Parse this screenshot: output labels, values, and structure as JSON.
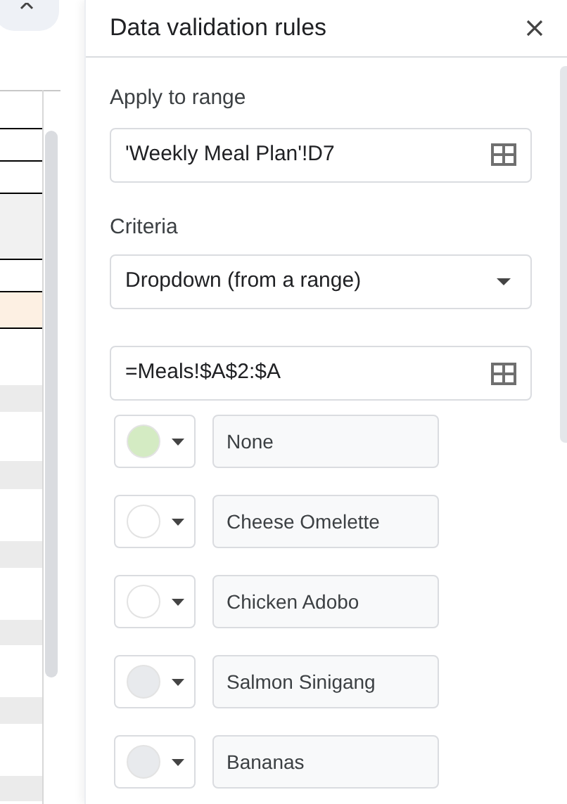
{
  "panel": {
    "title": "Data validation rules"
  },
  "apply_to_range": {
    "label": "Apply to range",
    "value": "'Weekly Meal Plan'!D7"
  },
  "criteria": {
    "label": "Criteria",
    "value": "Dropdown (from a range)",
    "range": "=Meals!$A$2:$A"
  },
  "options": [
    {
      "color": "#d4ebc3",
      "value": "None"
    },
    {
      "color": "#ffffff",
      "value": "Cheese Omelette"
    },
    {
      "color": "#ffffff",
      "value": "Chicken Adobo"
    },
    {
      "color": "#e8eaed",
      "value": "Salmon Sinigang"
    },
    {
      "color": "#e8eaed",
      "value": "Bananas"
    }
  ]
}
